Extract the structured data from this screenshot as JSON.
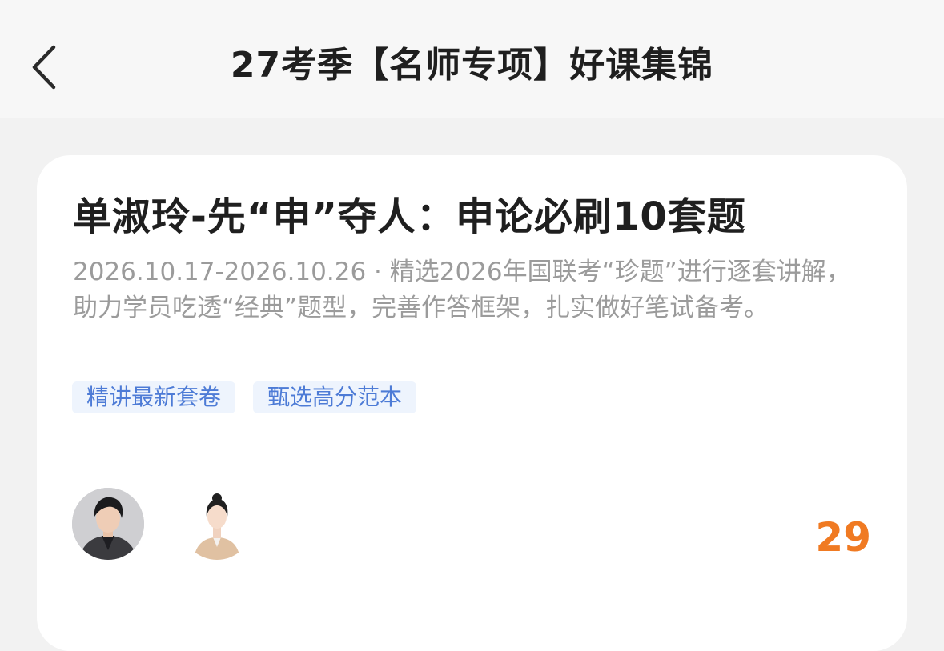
{
  "header": {
    "back_icon": "chevron-left-icon",
    "title": "27考季【名师专项】好课集锦"
  },
  "card": {
    "title": "单淑玲-先“申”夺人：申论必刷10套题",
    "description": "2026.10.17-2026.10.26 · 精选2026年国联考“珍题”进行逐套讲解，助力学员吃透“经典”题型，完善作答框架，扎实做好笔试备考。",
    "tags": [
      "精讲最新套卷",
      "甄选高分范本"
    ],
    "avatars": [
      "teacher-avatar-1",
      "teacher-avatar-2"
    ],
    "count": "29"
  },
  "colors": {
    "accent": "#f07a22",
    "tag_text": "#4d7bd6",
    "tag_bg": "#eef4fd"
  }
}
